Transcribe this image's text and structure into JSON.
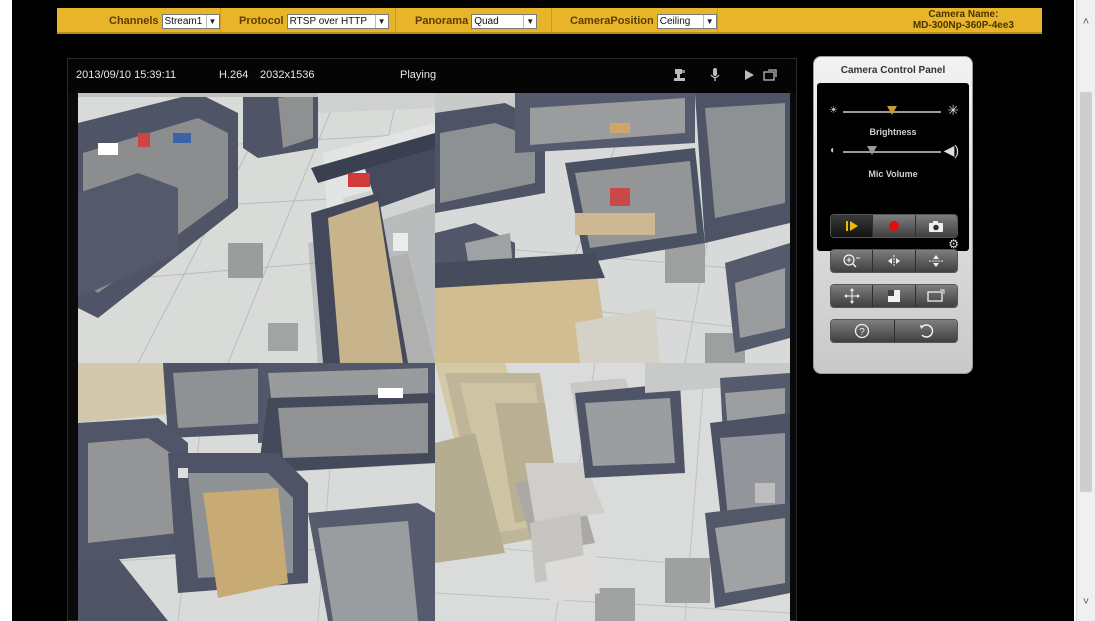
{
  "topbar": {
    "channels_label": "Channels",
    "channels_value": "Stream1",
    "protocol_label": "Protocol",
    "protocol_value": "RTSP over HTTP",
    "panorama_label": "Panorama",
    "panorama_value": "Quad",
    "camera_position_label": "CameraPosition",
    "camera_position_value": "Ceiling",
    "camera_name_label": "Camera Name:",
    "camera_name_value": "MD-300Np-360P-4ee3"
  },
  "status": {
    "datetime": "2013/09/10 15:39:11",
    "codec": "H.264",
    "resolution": "2032x1536",
    "state": "Playing"
  },
  "panel": {
    "title": "Camera Control Panel",
    "brightness_label": "Brightness",
    "brightness_level": 0.5,
    "mic_label": "Mic Volume",
    "mic_level": 0.3
  },
  "colors": {
    "topbar": "#e8b52a",
    "accent": "#c99b2c",
    "record": "#e01010",
    "play": "#f0b800"
  },
  "icons": {
    "status_bar": [
      "ptz-icon",
      "microphone-icon",
      "play-icon",
      "fullscreen-icon"
    ],
    "row1": [
      "play-icon",
      "record-icon",
      "snapshot-icon"
    ],
    "row2": [
      "zoom-in-icon",
      "mirror-horizontal-icon",
      "flip-vertical-icon"
    ],
    "row3": [
      "move-icon",
      "corner-crop-icon",
      "aspect-ratio-icon"
    ],
    "row4": [
      "help-icon",
      "reset-icon"
    ]
  }
}
